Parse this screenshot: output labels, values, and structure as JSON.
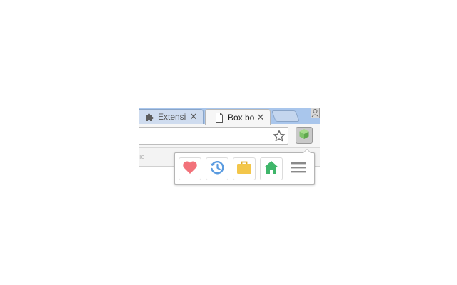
{
  "tabs": [
    {
      "title": "Extensi",
      "icon": "puzzle-icon",
      "active": false
    },
    {
      "title": "Box bo",
      "icon": "page-icon",
      "active": true
    }
  ],
  "tab_close_glyph": "✕",
  "bookmark_bar": {
    "partial_text": "ıe"
  },
  "popup": {
    "buttons": [
      {
        "name": "favorites-button",
        "icon": "heart-icon",
        "color": "#f2727a"
      },
      {
        "name": "history-button",
        "icon": "history-icon",
        "color": "#5a9be0"
      },
      {
        "name": "briefcase-button",
        "icon": "briefcase-icon",
        "color": "#f3c64a"
      },
      {
        "name": "home-button",
        "icon": "home-icon",
        "color": "#3fb66a"
      },
      {
        "name": "menu-button",
        "icon": "hamburger-icon",
        "color": "#8a8a8a"
      }
    ]
  },
  "colors": {
    "tabstrip": "#a9c6ec",
    "extension_icon": "#7fc36a"
  }
}
